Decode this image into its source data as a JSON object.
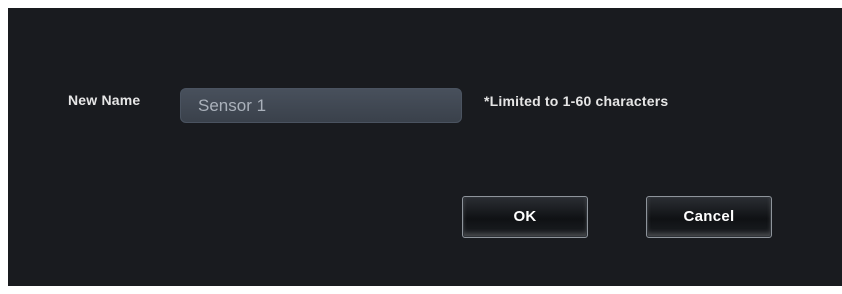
{
  "form": {
    "name_label": "New Name",
    "name_value": "Sensor 1",
    "hint": "*Limited to 1-60 characters"
  },
  "buttons": {
    "ok_label": "OK",
    "cancel_label": "Cancel"
  },
  "colors": {
    "dialog_background": "#191b1f",
    "input_background": "#414852",
    "text": "#e6e6e6"
  }
}
